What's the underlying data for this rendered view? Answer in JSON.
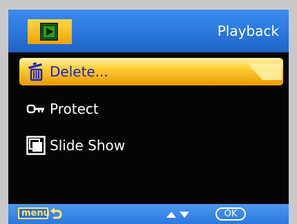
{
  "header": {
    "mode_icon": "play-mode-icon",
    "title": "Playback"
  },
  "menu": {
    "items": [
      {
        "label": "Delete...",
        "icon": "trash-icon",
        "selected": true
      },
      {
        "label": "Protect",
        "icon": "key-icon",
        "selected": false
      },
      {
        "label": "Slide Show",
        "icon": "slideshow-icon",
        "selected": false
      }
    ]
  },
  "footer": {
    "menu_label": "menu",
    "back_icon": "return-arrow-icon",
    "nav_icon": "up-down-arrows-icon",
    "ok_label": "OK"
  },
  "colors": {
    "header_blue": "#2a76dc",
    "selection_yellow": "#f5b400",
    "selected_text": "#1d24c4",
    "background": "#050505"
  }
}
